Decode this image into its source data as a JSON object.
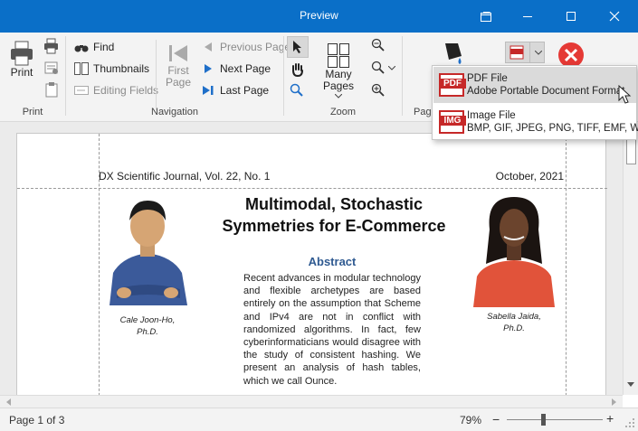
{
  "window": {
    "title": "Preview",
    "controls": [
      "restore",
      "maximize",
      "close"
    ]
  },
  "ribbon": {
    "print_group": {
      "label": "Print",
      "print_label": "Print"
    },
    "navigation_group": {
      "label": "Navigation",
      "find": "Find",
      "thumbnails": "Thumbnails",
      "editing_fields": "Editing Fields",
      "first_page": "First Page",
      "previous_page": "Previous Page",
      "next_page": "Next Page",
      "last_page": "Last Page"
    },
    "zoom_group": {
      "label": "Zoom",
      "many_pages": "Many Pages"
    },
    "page_group_label": "Pag"
  },
  "export_menu": {
    "items": [
      {
        "title": "PDF File",
        "description": "Adobe Portable Document Format",
        "icon_text": "PDF"
      },
      {
        "title": "Image File",
        "description": "BMP, GIF, JPEG, PNG, TIFF, EMF, WMF",
        "icon_text": "IMG"
      }
    ]
  },
  "document": {
    "header_left": "DX Scientific Journal, Vol. 22, No. 1",
    "header_right": "October, 2021",
    "title_line1": "Multimodal, Stochastic",
    "title_line2": "Symmetries for E-Commerce",
    "abstract_heading": "Abstract",
    "abstract_text": "Recent advances in modular technology and flexible archetypes are based entirely on the assumption that Scheme and IPv4 are not in conflict with randomized algorithms. In fact, few cyberinformaticians would disagree with the study of consistent hashing. We present an analysis of hash tables, which we call Ounce.",
    "author1": {
      "name": "Cale Joon-Ho,",
      "degree": "Ph.D."
    },
    "author2": {
      "name": "Sabella Jaida,",
      "degree": "Ph.D."
    }
  },
  "status": {
    "page_info": "Page 1 of 3",
    "zoom": "79%",
    "zoom_minus": "−",
    "zoom_plus": "+",
    "zoom_level_fraction": 0.38
  },
  "colors": {
    "titlebar": "#0a6fc8",
    "accent_blue": "#1f6fc9",
    "close_red": "#e53935",
    "pdf_red": "#c62828",
    "abstract_heading": "#2f5a91"
  }
}
